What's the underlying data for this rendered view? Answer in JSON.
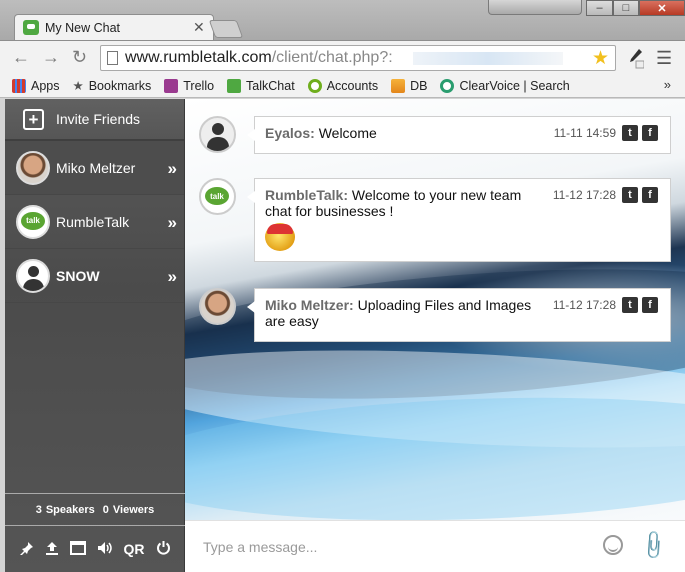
{
  "browser": {
    "tab_title": "My New Chat",
    "tab_close": "✕",
    "url_host": "www.rumbletalk.com",
    "url_path": "/client/chat.php?:",
    "window_controls": {
      "minimize": "–",
      "maximize": "□",
      "close": "✕"
    },
    "nav": {
      "back": "←",
      "forward": "→",
      "reload": "↻",
      "star": "★",
      "menu": "☰"
    },
    "bookmarks": [
      {
        "label": "Apps",
        "color": "#d23b2f",
        "icon": "apps-grid-icon"
      },
      {
        "label": "Bookmarks",
        "color": "#555555",
        "icon": "star-icon"
      },
      {
        "label": "Trello",
        "color": "#9a3a8f",
        "icon": "trello-icon"
      },
      {
        "label": "TalkChat",
        "color": "#4fa841",
        "icon": "talkchat-icon"
      },
      {
        "label": "Accounts",
        "color": "#6fae1d",
        "icon": "accounts-icon"
      },
      {
        "label": "DB",
        "color": "#e3a01b",
        "icon": "phpmyadmin-icon"
      },
      {
        "label": "ClearVoice | Search",
        "color": "#2a9d6f",
        "icon": "clearvoice-icon"
      }
    ],
    "bookmarks_more": "»"
  },
  "sidebar": {
    "invite_label": "Invite Friends",
    "members": [
      {
        "name": "Miko Meltzer",
        "avatar": "photo"
      },
      {
        "name": "RumbleTalk",
        "avatar": "talk-logo",
        "logo_text": "talk"
      },
      {
        "name": "SNOW",
        "avatar": "default-user"
      }
    ],
    "chevron": "»",
    "speakers_count": "3",
    "speakers_label": "Speakers",
    "viewers_count": "0",
    "viewers_label": "Viewers",
    "tools": {
      "pin": "📌",
      "upload": "⬆",
      "window": "▭",
      "sound": "🔊",
      "qr": "QR",
      "power": "⏻"
    }
  },
  "chat": {
    "messages": [
      {
        "sender": "Eyalos:",
        "text": "Welcome",
        "time": "11-11 14:59"
      },
      {
        "sender": "RumbleTalk:",
        "text": "Welcome to your new team chat for businesses !",
        "time": "11-12 17:28",
        "has_emoji": true
      },
      {
        "sender": "Miko Meltzer:",
        "text": "Uploading Files and Images are easy",
        "time": "11-12 17:28"
      }
    ],
    "social": {
      "twitter": "t",
      "facebook": "f"
    },
    "composer_placeholder": "Type a message..."
  },
  "colors": {
    "sidebar_bg": "#555555",
    "accent_green": "#4fa841",
    "sender_gray": "#6b6b6b"
  }
}
